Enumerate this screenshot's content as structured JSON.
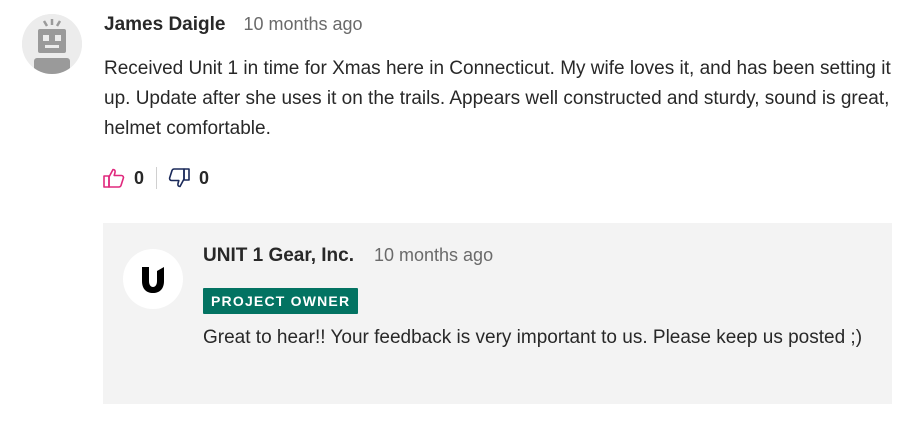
{
  "comment": {
    "author": "James Daigle",
    "timestamp": "10 months ago",
    "body": "Received Unit 1 in time for Xmas here in Connecticut. My wife loves it, and has been setting it up. Update after she uses it on the trails. Appears well constructed and sturdy, sound is great, helmet comfortable.",
    "avatar_icon": "robot-avatar-icon",
    "likes": "0",
    "dislikes": "0",
    "like_icon": "thumbs-up-icon",
    "dislike_icon": "thumbs-down-icon"
  },
  "reply": {
    "author": "UNIT 1 Gear, Inc.",
    "timestamp": "10 months ago",
    "badge": "PROJECT OWNER",
    "body": "Great to hear!! Your feedback is very important to us. Please keep us posted ;)",
    "avatar_icon": "unit1-logo-icon"
  },
  "colors": {
    "like_accent": "#e0287d",
    "dislike_accent": "#1b2a5a",
    "badge_bg": "#037362",
    "reply_bg": "#f3f3f3"
  }
}
